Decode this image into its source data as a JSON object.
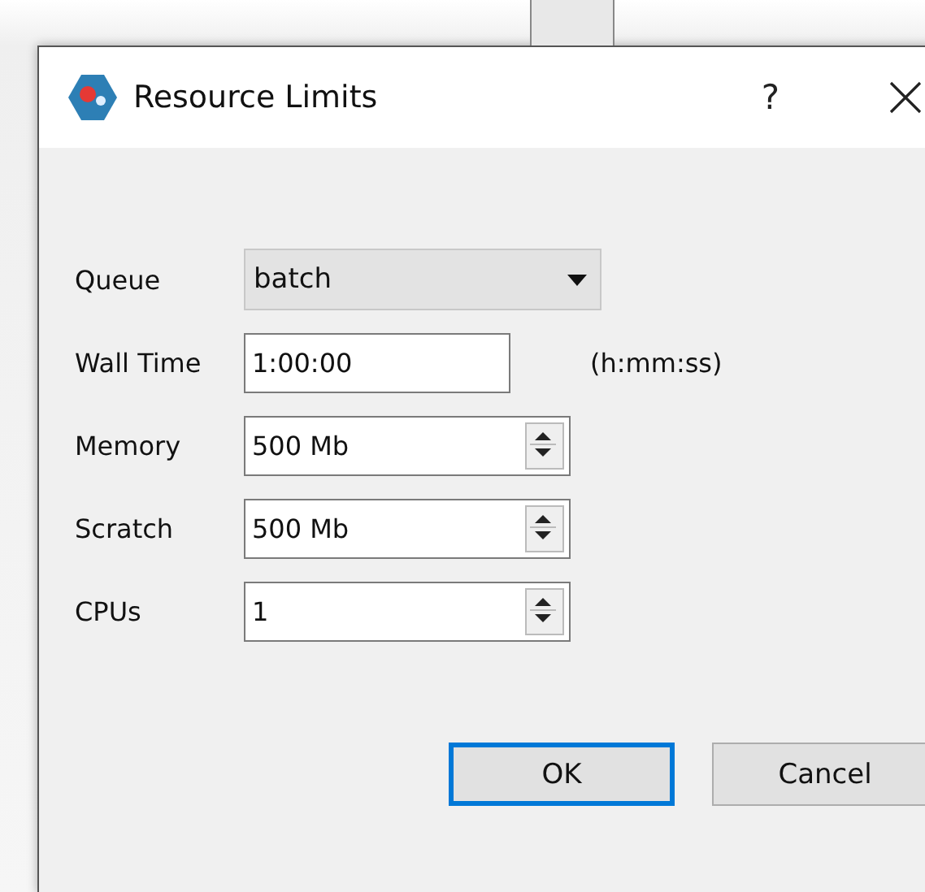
{
  "window": {
    "title": "Resource Limits",
    "help": "?"
  },
  "fields": [
    {
      "kind": "combo",
      "label": "Queue",
      "value": "batch"
    },
    {
      "kind": "text",
      "label": "Wall Time",
      "value": "1:00:00",
      "hint": "(h:mm:ss)"
    },
    {
      "kind": "spin",
      "label": "Memory",
      "value": "500 Mb"
    },
    {
      "kind": "spin",
      "label": "Scratch",
      "value": "500 Mb"
    },
    {
      "kind": "spin",
      "label": "CPUs",
      "value": "1"
    }
  ],
  "buttons": [
    {
      "label": "OK",
      "default": true
    },
    {
      "label": "Cancel",
      "default": false
    }
  ]
}
